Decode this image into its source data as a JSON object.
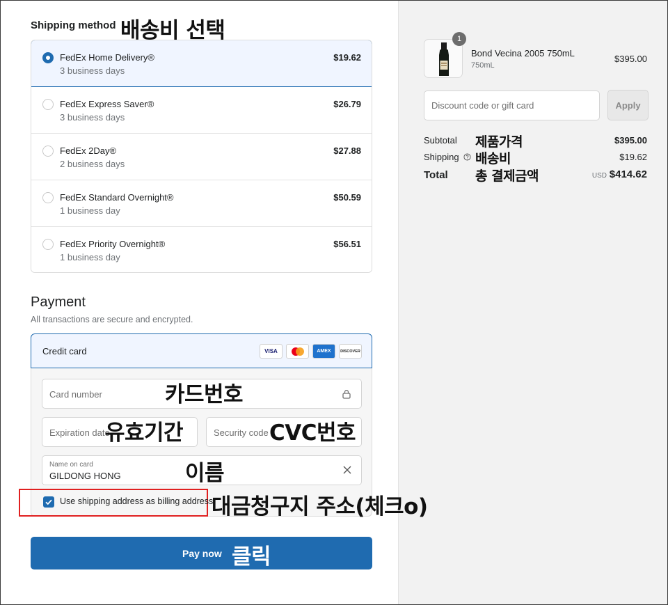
{
  "shipping": {
    "title": "Shipping method",
    "options": [
      {
        "name": "FedEx Home Delivery®",
        "days": "3 business days",
        "price": "$19.62",
        "selected": true
      },
      {
        "name": "FedEx Express Saver®",
        "days": "3 business days",
        "price": "$26.79",
        "selected": false
      },
      {
        "name": "FedEx 2Day®",
        "days": "2 business days",
        "price": "$27.88",
        "selected": false
      },
      {
        "name": "FedEx Standard Overnight®",
        "days": "1 business day",
        "price": "$50.59",
        "selected": false
      },
      {
        "name": "FedEx Priority Overnight®",
        "days": "1 business day",
        "price": "$56.51",
        "selected": false
      }
    ]
  },
  "payment": {
    "title": "Payment",
    "subtitle": "All transactions are secure and encrypted.",
    "method_label": "Credit card",
    "card_brands": [
      "VISA",
      "",
      "AMEX",
      "DISCOVER"
    ],
    "card_number_placeholder": "Card number",
    "expiration_placeholder": "Expiration date",
    "security_code_placeholder": "Security code",
    "name_label": "Name on card",
    "name_value": "GILDONG HONG",
    "billing_checkbox_label": "Use shipping address as billing address",
    "billing_checked": true,
    "pay_button": "Pay now"
  },
  "annotations": {
    "shipping": "배송비 선택",
    "card_number": "카드번호",
    "expiration": "유효기간",
    "cvc": "CVC번호",
    "name": "이름",
    "billing": "대금청구지 주소(체크o)",
    "pay": "클릭",
    "subtotal": "제품가격",
    "shipping_fee": "배송비",
    "total": "총 결제금액"
  },
  "order": {
    "item": {
      "name": "Bond Vecina 2005 750mL",
      "variant": "750mL",
      "price": "$395.00",
      "quantity": "1"
    },
    "discount_placeholder": "Discount code or gift card",
    "apply_label": "Apply",
    "subtotal_label": "Subtotal",
    "subtotal_value": "$395.00",
    "shipping_label": "Shipping",
    "shipping_value": "$19.62",
    "total_label": "Total",
    "currency": "USD",
    "total_value": "$414.62"
  },
  "colors": {
    "accent": "#1f6bb0",
    "highlight_box": "#e02020",
    "panel_bg": "#f2f2f2"
  }
}
